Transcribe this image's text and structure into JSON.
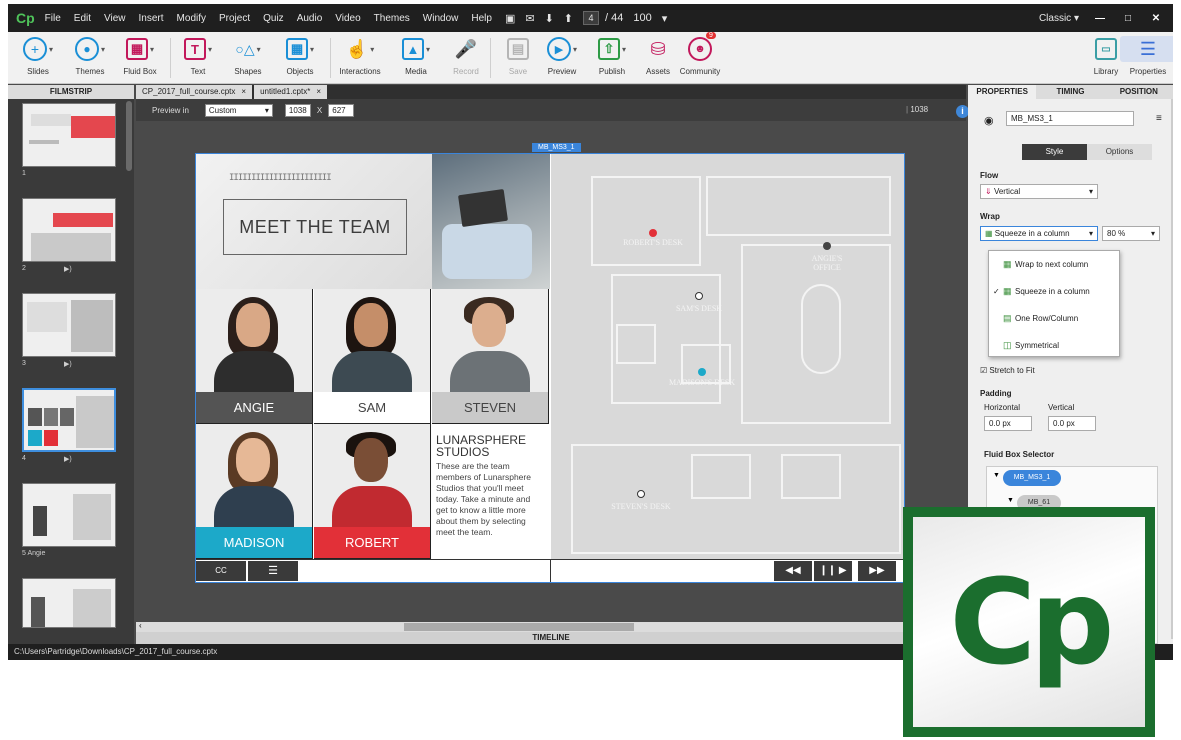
{
  "app": {
    "logo": "Cp",
    "menu": [
      "File",
      "Edit",
      "View",
      "Insert",
      "Modify",
      "Project",
      "Quiz",
      "Audio",
      "Video",
      "Themes",
      "Window",
      "Help"
    ],
    "slide_current": "4",
    "slide_total": "/ 44",
    "zoom": "100",
    "workspace": "Classic"
  },
  "toolbar": {
    "slides": "Slides",
    "themes": "Themes",
    "fluid_box": "Fluid Box",
    "text": "Text",
    "shapes": "Shapes",
    "objects": "Objects",
    "interactions": "Interactions",
    "media": "Media",
    "record": "Record",
    "save": "Save",
    "preview": "Preview",
    "publish": "Publish",
    "assets": "Assets",
    "community": "Community",
    "community_badge": "9",
    "library": "Library",
    "properties": "Properties"
  },
  "filmstrip": {
    "title": "FILMSTRIP",
    "slides": [
      {
        "label": "1",
        "audio": false
      },
      {
        "label": "2",
        "audio": true
      },
      {
        "label": "3",
        "audio": true
      },
      {
        "label": "4",
        "audio": true
      },
      {
        "label": "5 Angie",
        "audio": false
      },
      {
        "label": "",
        "audio": false
      }
    ]
  },
  "tabs": [
    "CP_2017_full_course.cptx",
    "untitled1.cptx*"
  ],
  "preview": {
    "label": "Preview in",
    "device": "Custom",
    "width": "1038",
    "x": "X",
    "height": "627",
    "ruler": "1038"
  },
  "stage": {
    "fluid_box_name": "MB_MS3_1",
    "title": "MEET THE TEAM",
    "barcode": "IIIIIIIIIIIIIIIIIIIIIII",
    "people": [
      {
        "name": "ANGIE",
        "plate_color": "#545454",
        "text_color": "#ffffff"
      },
      {
        "name": "SAM",
        "plate_color": "#ffffff",
        "text_color": "#444444"
      },
      {
        "name": "STEVEN",
        "plate_color": "#c9c9c9",
        "text_color": "#444444"
      },
      {
        "name": "MADISON",
        "plate_color": "#1ca9c9",
        "text_color": "#ffffff"
      },
      {
        "name": "ROBERT",
        "plate_color": "#e23038",
        "text_color": "#ffffff"
      }
    ],
    "company_title": "LUNARSPHERE STUDIOS",
    "company_text": "These are the team members of Lunarsphere Studios that you'll meet today. Take a minute and get to know a little more about them by selecting meet the team.",
    "cc": "CC",
    "floorplan": {
      "roberts_desk": "ROBERT'S DESK",
      "angies_office": "ANGIE'S OFFICE",
      "sams_desk": "SAM'S DESK",
      "madisons_desk": "MADISON'S DESK",
      "stevens_desk": "STEVEN'S DESK"
    }
  },
  "timeline_label": "TIMELINE",
  "status_path": "C:\\Users\\Partridge\\Downloads\\CP_2017_full_course.cptx",
  "properties": {
    "tabs": [
      "PROPERTIES",
      "TIMING",
      "POSITION"
    ],
    "object_name": "MB_MS3_1",
    "style_tab": "Style",
    "options_tab": "Options",
    "flow_label": "Flow",
    "flow_value": "Vertical",
    "wrap_label": "Wrap",
    "wrap_value": "Squeeze in a column",
    "wrap_percent": "80 %",
    "wrap_options": [
      "Wrap to next column",
      "Squeeze in a column",
      "One Row/Column",
      "Symmetrical"
    ],
    "stretch_label": "Stretch to Fit",
    "padding_label": "Padding",
    "horizontal_label": "Horizontal",
    "vertical_label": "Vertical",
    "padding_h": "0.0 px",
    "padding_v": "0.0 px",
    "selector_label": "Fluid Box Selector",
    "tree": [
      "MB_MS3_1",
      "MB_61"
    ]
  },
  "logo_overlay": "Cp"
}
